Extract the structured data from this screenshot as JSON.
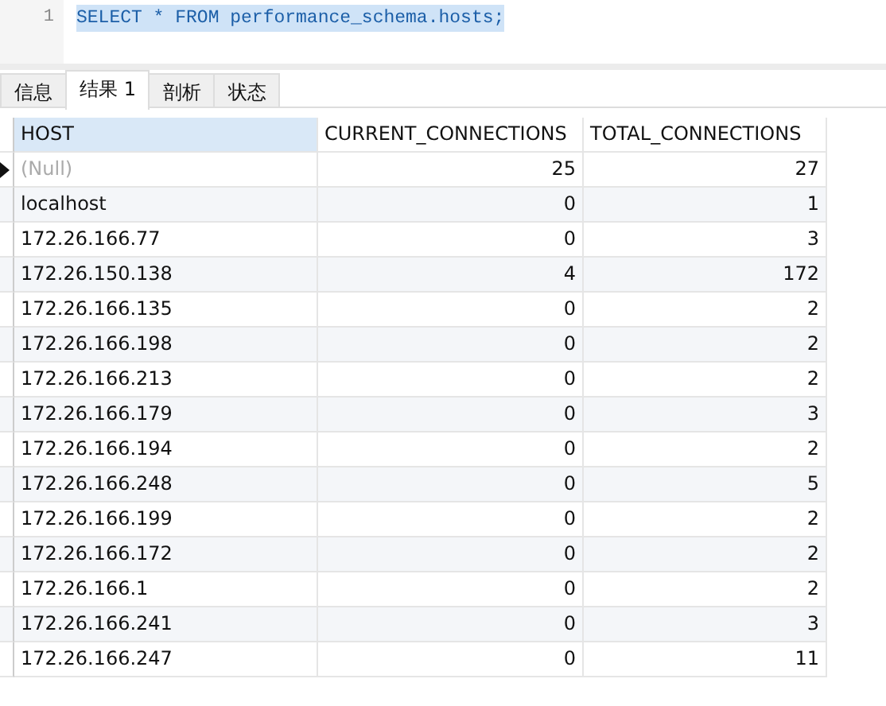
{
  "editor": {
    "lines": [
      {
        "number": "1",
        "code": "SELECT * FROM performance_schema.hosts;",
        "selected": true
      }
    ]
  },
  "tabs": [
    {
      "label": "信息",
      "selected": false
    },
    {
      "label": "结果 1",
      "selected": true
    },
    {
      "label": "剖析",
      "selected": false
    },
    {
      "label": "状态",
      "selected": false
    }
  ],
  "table": {
    "columns": [
      {
        "label": "HOST",
        "selected": true
      },
      {
        "label": "CURRENT_CONNECTIONS",
        "selected": false
      },
      {
        "label": "TOTAL_CONNECTIONS",
        "selected": false
      }
    ],
    "rows": [
      {
        "current": true,
        "cells": [
          {
            "text": "(Null)",
            "kind": "null"
          },
          {
            "text": "25",
            "kind": "value"
          },
          {
            "text": "27",
            "kind": "value"
          }
        ]
      },
      {
        "current": false,
        "cells": [
          {
            "text": "localhost",
            "kind": "value"
          },
          {
            "text": "0",
            "kind": "value"
          },
          {
            "text": "1",
            "kind": "value"
          }
        ]
      },
      {
        "current": false,
        "cells": [
          {
            "text": "172.26.166.77",
            "kind": "value"
          },
          {
            "text": "0",
            "kind": "value"
          },
          {
            "text": "3",
            "kind": "value"
          }
        ]
      },
      {
        "current": false,
        "cells": [
          {
            "text": "172.26.150.138",
            "kind": "value"
          },
          {
            "text": "4",
            "kind": "value"
          },
          {
            "text": "172",
            "kind": "value"
          }
        ]
      },
      {
        "current": false,
        "cells": [
          {
            "text": "172.26.166.135",
            "kind": "value"
          },
          {
            "text": "0",
            "kind": "value"
          },
          {
            "text": "2",
            "kind": "value"
          }
        ]
      },
      {
        "current": false,
        "cells": [
          {
            "text": "172.26.166.198",
            "kind": "value"
          },
          {
            "text": "0",
            "kind": "value"
          },
          {
            "text": "2",
            "kind": "value"
          }
        ]
      },
      {
        "current": false,
        "cells": [
          {
            "text": "172.26.166.213",
            "kind": "value"
          },
          {
            "text": "0",
            "kind": "value"
          },
          {
            "text": "2",
            "kind": "value"
          }
        ]
      },
      {
        "current": false,
        "cells": [
          {
            "text": "172.26.166.179",
            "kind": "value"
          },
          {
            "text": "0",
            "kind": "value"
          },
          {
            "text": "3",
            "kind": "value"
          }
        ]
      },
      {
        "current": false,
        "cells": [
          {
            "text": "172.26.166.194",
            "kind": "value"
          },
          {
            "text": "0",
            "kind": "value"
          },
          {
            "text": "2",
            "kind": "value"
          }
        ]
      },
      {
        "current": false,
        "cells": [
          {
            "text": "172.26.166.248",
            "kind": "value"
          },
          {
            "text": "0",
            "kind": "value"
          },
          {
            "text": "5",
            "kind": "value"
          }
        ]
      },
      {
        "current": false,
        "cells": [
          {
            "text": "172.26.166.199",
            "kind": "value"
          },
          {
            "text": "0",
            "kind": "value"
          },
          {
            "text": "2",
            "kind": "value"
          }
        ]
      },
      {
        "current": false,
        "cells": [
          {
            "text": "172.26.166.172",
            "kind": "value"
          },
          {
            "text": "0",
            "kind": "value"
          },
          {
            "text": "2",
            "kind": "value"
          }
        ]
      },
      {
        "current": false,
        "cells": [
          {
            "text": "172.26.166.1",
            "kind": "value"
          },
          {
            "text": "0",
            "kind": "value"
          },
          {
            "text": "2",
            "kind": "value"
          }
        ]
      },
      {
        "current": false,
        "cells": [
          {
            "text": "172.26.166.241",
            "kind": "value"
          },
          {
            "text": "0",
            "kind": "value"
          },
          {
            "text": "3",
            "kind": "value"
          }
        ]
      },
      {
        "current": false,
        "cells": [
          {
            "text": "172.26.166.247",
            "kind": "value"
          },
          {
            "text": "0",
            "kind": "value"
          },
          {
            "text": "11",
            "kind": "value"
          }
        ]
      }
    ]
  }
}
